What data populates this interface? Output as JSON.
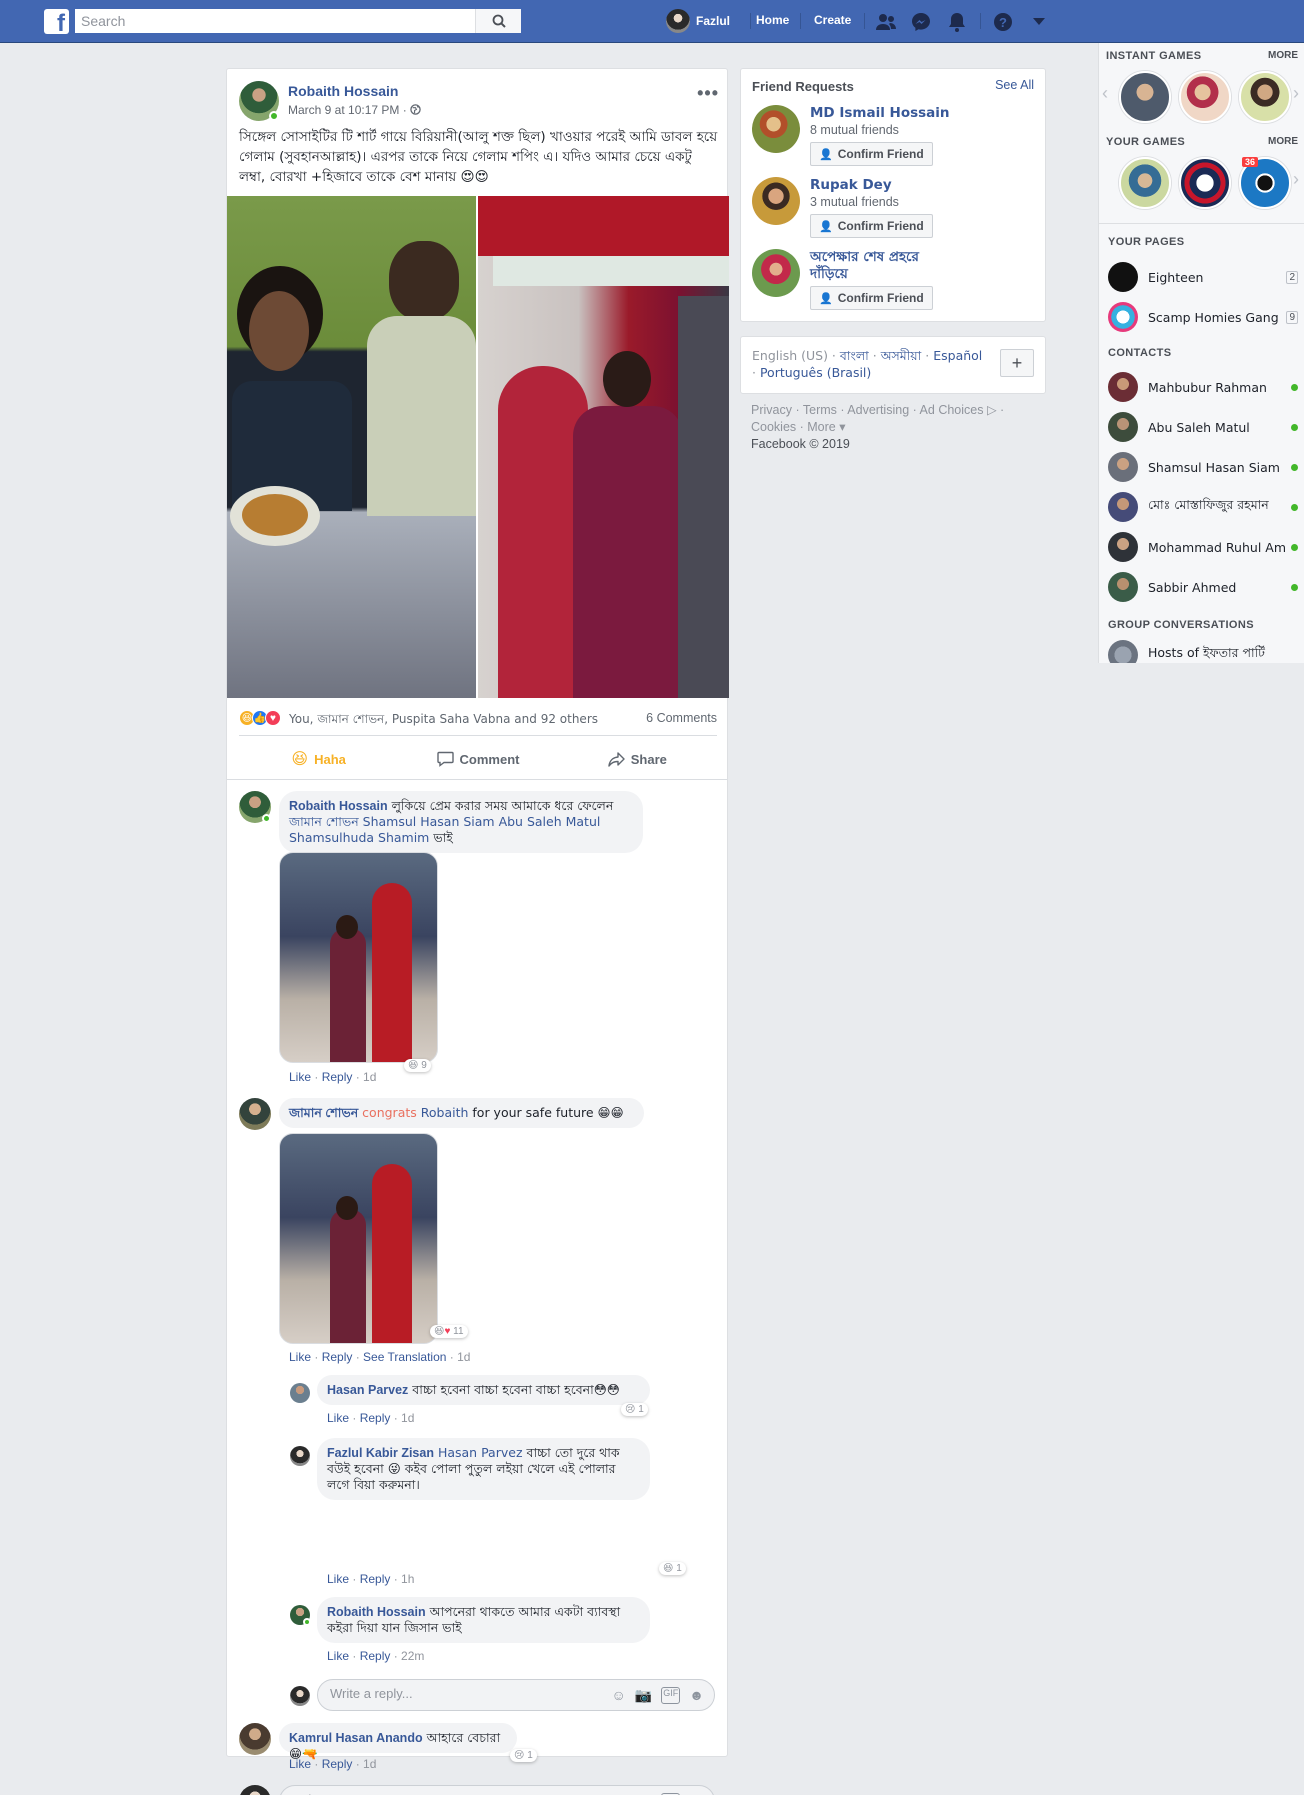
{
  "topbar": {
    "search_placeholder": "Search",
    "user_name": "Fazlul",
    "home": "Home",
    "create": "Create"
  },
  "post": {
    "author": "Robaith Hossain",
    "time": "March 9 at 10:17 PM ·",
    "text": "সিঙ্গেল সোসাইটির টি শার্ট গায়ে বিরিয়ানী(আলু শক্ত ছিল) খাওয়ার পরেই আমি ডাবল হয়ে গেলাম (সুবহানআল্লাহ)। এরপর তাকে নিয়ে গেলাম শপিং এ। যদিও আমার চেয়ে একটু লম্বা, বোরখা +হিজাবে তাকে বেশ মানায় 😍😍",
    "reactions_text": "You, জামান শোভন, Puspita Saha Vabna and 92 others",
    "comments_count": "6 Comments",
    "actions": {
      "haha": "Haha",
      "comment": "Comment",
      "share": "Share"
    }
  },
  "comments": [
    {
      "author": "Robaith Hossain",
      "text": " লুকিয়ে প্রেম করার সময় আমাকে ধরে ফেলেন ",
      "tags": "জামান শোভন Shamsul Hasan Siam Abu Saleh Matul Shamsulhuda Shamim",
      "tail": " ভাই",
      "like": "Like",
      "reply": "Reply",
      "date": "1d",
      "img_react": "9"
    },
    {
      "author": "জামান শোভন",
      "word1": "congrats",
      "word2": "Robaith",
      "text": " for your safe future 😁😁",
      "like": "Like",
      "reply": "Reply",
      "translate": "See Translation",
      "date": "1d",
      "img_react": "11"
    }
  ],
  "replies": [
    {
      "author": "Hasan Parvez",
      "text": " বাচ্চা হবেনা বাচ্চা হবেনা বাচ্চা হবেনা😳😳",
      "like": "Like",
      "reply": "Reply",
      "date": "1d",
      "react": "1"
    },
    {
      "author": "Fazlul Kabir Zisan",
      "tag": "Hasan Parvez",
      "text": " বাচ্চা তো দুরে থাক বউই হবেনা 😜 কইব পোলা পুতুল লইয়া খেলে এই পোলার লগে বিয়া করুমনা।",
      "like": "Like",
      "reply": "Reply",
      "date": "1h",
      "react": "1"
    },
    {
      "author": "Robaith Hossain",
      "text": " আপনেরা থাকতে আমার একটা ব্যাবস্থা কইরা দিয়া যান জিসান ভাই",
      "like": "Like",
      "reply": "Reply",
      "date": "22m"
    }
  ],
  "reply_placeholder": "Write a reply...",
  "last_comment": {
    "author": "Kamrul Hasan Anando",
    "text": " আহারে বেচারা 😁🔫",
    "like": "Like",
    "reply": "Reply",
    "date": "1d",
    "react": "1"
  },
  "comment_placeholder": "Write a comment...",
  "friend_requests": {
    "title": "Friend Requests",
    "see_all": "See All",
    "confirm_label": "Confirm Friend",
    "items": [
      {
        "name": "MD Ismail Hossain",
        "mutual": "8 mutual friends"
      },
      {
        "name": "Rupak Dey",
        "mutual": "3 mutual friends"
      },
      {
        "name": "অপেক্ষার শেষ প্রহরে দাঁড়িয়ে",
        "mutual": ""
      }
    ]
  },
  "languages": {
    "current": "English (US)",
    "options": [
      "বাংলা",
      "অসমীয়া",
      "Español",
      "Português (Brasil)"
    ]
  },
  "footer": {
    "line1": "Privacy · Terms · Advertising · Ad Choices ▷ ·",
    "line2": "Cookies · More ▾",
    "copyright": "Facebook © 2019"
  },
  "right_column": {
    "instant_games": "INSTANT GAMES",
    "your_games": "YOUR GAMES",
    "more": "MORE",
    "game_badge": "36",
    "your_pages": "YOUR PAGES",
    "pages": [
      {
        "name": "Eighteen",
        "badge": "2"
      },
      {
        "name": "Scamp Homies Gang",
        "badge": "9"
      }
    ],
    "contacts_title": "CONTACTS",
    "contacts": [
      "Mahbubur Rahman",
      "Abu Saleh Matul",
      "Shamsul Hasan Siam",
      "মোঃ মোস্তাফিজুর রহমান",
      "Mohammad Ruhul Amin",
      "Sabbir Ahmed"
    ],
    "group_title": "GROUP CONVERSATIONS",
    "group_first": "Hosts of ইফতার পার্টি"
  },
  "colors": {
    "brand": "#4267b2",
    "link": "#385898",
    "online": "#42b72a",
    "haha": "#f7b125"
  }
}
